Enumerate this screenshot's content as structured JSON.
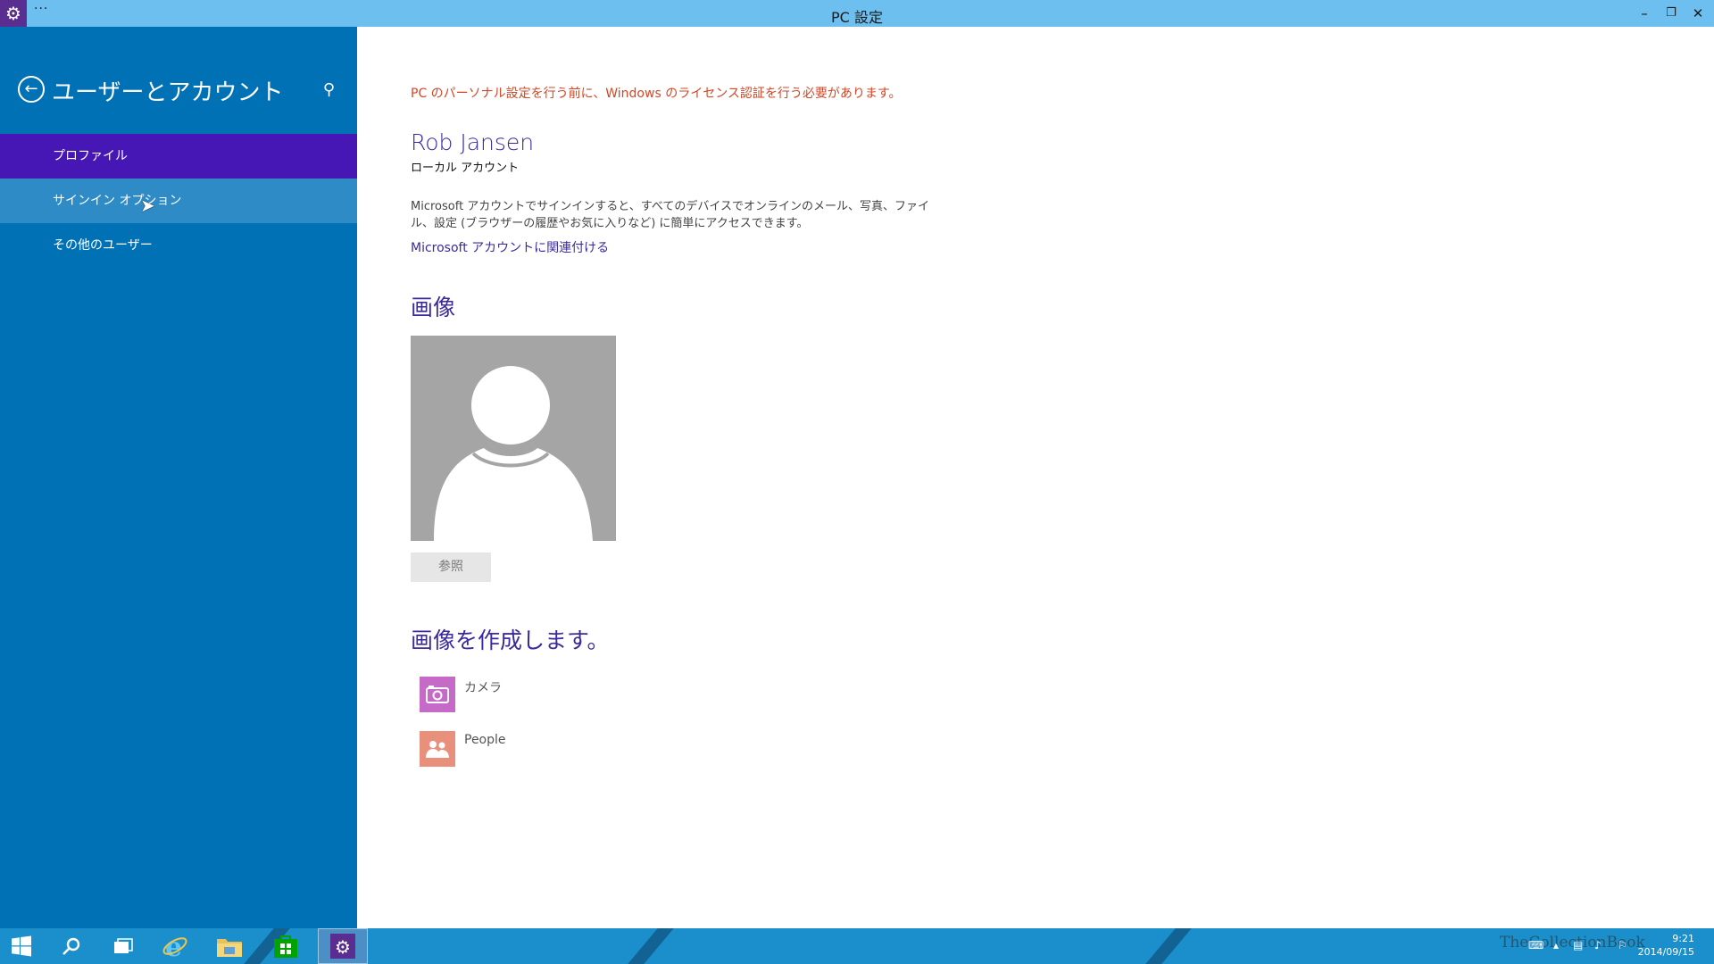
{
  "window": {
    "title": "PC 設定",
    "menu_dots": "···",
    "minimize": "–",
    "restore": "❐",
    "close": "✕"
  },
  "sidebar": {
    "title": "ユーザーとアカウント",
    "items": [
      {
        "label": "プロファイル",
        "state": "selected"
      },
      {
        "label": "サインイン オプション",
        "state": "hover"
      },
      {
        "label": "その他のユーザー",
        "state": "normal"
      }
    ]
  },
  "main": {
    "warning": "PC のパーソナル設定を行う前に、Windows のライセンス認証を行う必要があります。",
    "user_name": "Rob Jansen",
    "account_type": "ローカル アカウント",
    "description": "Microsoft アカウントでサインインすると、すべてのデバイスでオンラインのメール、写真、ファイル、設定 (ブラウザーの履歴やお気に入りなど) に簡単にアクセスできます。",
    "link": "Microsoft アカウントに関連付ける",
    "picture_heading": "画像",
    "browse_button": "参照",
    "create_heading": "画像を作成します。",
    "apps": [
      {
        "label": "カメラ",
        "icon": "camera-icon",
        "color": "#c56bc7"
      },
      {
        "label": "People",
        "icon": "people-icon",
        "color": "#e8907c"
      }
    ]
  },
  "taskbar": {
    "time": "9:21",
    "date": "2014/09/15",
    "watermark": "TheCollectionBook",
    "apps": [
      "windows-start-icon",
      "search-icon",
      "task-view-icon",
      "internet-explorer-icon",
      "file-explorer-icon",
      "store-icon",
      "settings-icon"
    ]
  },
  "colors": {
    "titlebar": "#6cbfef",
    "sidebar": "#0071b4",
    "selected": "#4617b4",
    "accent_text": "#3b2a9e",
    "warning": "#d24726",
    "taskbar": "#1b8fcb"
  }
}
